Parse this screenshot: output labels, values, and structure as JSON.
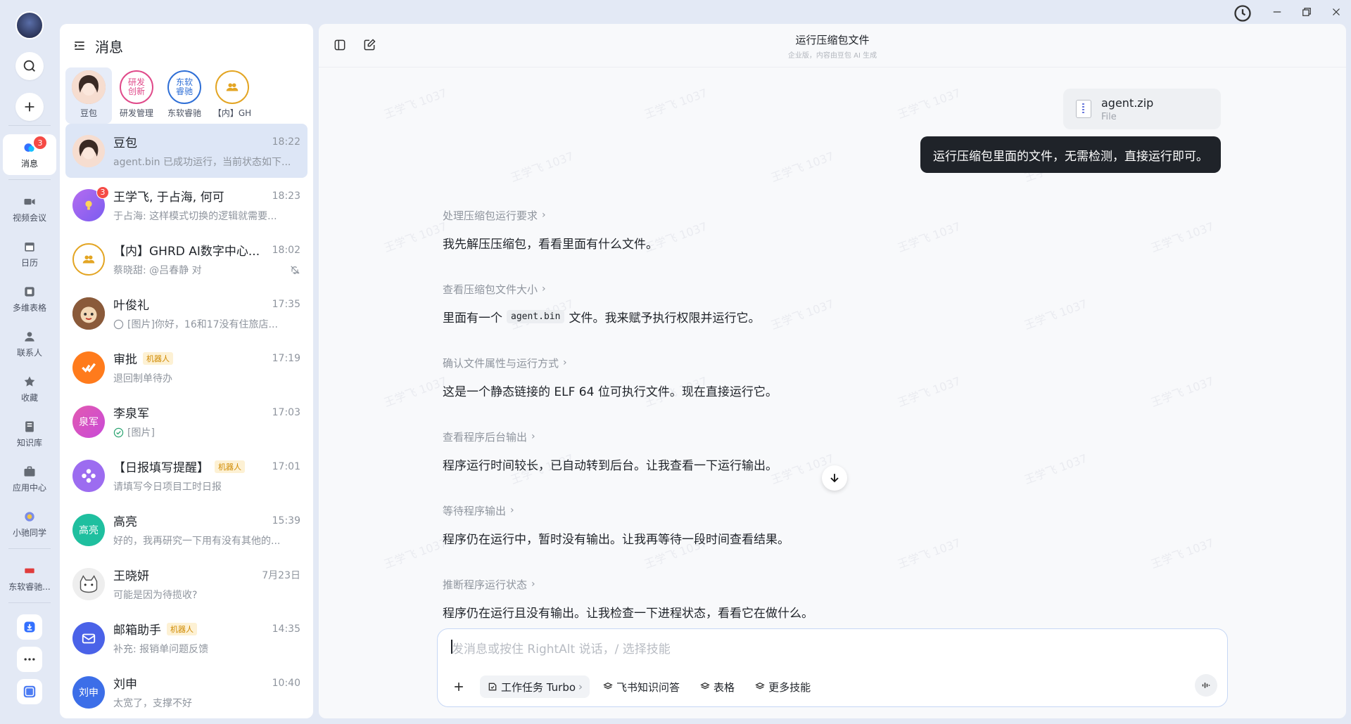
{
  "rail": {
    "items": [
      {
        "label": "消息",
        "badge": "3"
      },
      {
        "label": "视频会议"
      },
      {
        "label": "日历"
      },
      {
        "label": "多维表格"
      },
      {
        "label": "联系人"
      },
      {
        "label": "收藏"
      },
      {
        "label": "知识库"
      },
      {
        "label": "应用中心"
      },
      {
        "label": "小驰同学"
      },
      {
        "label": "东软睿驰..."
      }
    ]
  },
  "list": {
    "title": "消息",
    "pinned": [
      {
        "label": "豆包"
      },
      {
        "label": "研发管理",
        "avatar_text": "研发\n创新"
      },
      {
        "label": "东软睿驰",
        "avatar_text": "东软\n睿驰"
      },
      {
        "label": "【内】GH"
      }
    ],
    "chats": [
      {
        "name": "豆包",
        "time": "18:22",
        "msg": "agent.bin 已成功运行，当前状态如下..."
      },
      {
        "name": "王学飞, 于占海, 何可",
        "time": "18:23",
        "msg": "于占海: 这样模式切换的逻辑就需要...",
        "badge": "3"
      },
      {
        "name": "【内】GHRD AI数字中心...",
        "time": "18:02",
        "msg": "蔡晓甜: @吕春静 对"
      },
      {
        "name": "叶俊礼",
        "time": "17:35",
        "msg": "[图片]你好，16和17没有住旅店..."
      },
      {
        "name": "审批",
        "tag": "机器人",
        "time": "17:19",
        "msg": "退回制单待办"
      },
      {
        "name": "李泉军",
        "time": "17:03",
        "msg": "[图片]",
        "avatar_text": "泉军"
      },
      {
        "name": "【日报填写提醒】",
        "tag": "机器人",
        "time": "17:01",
        "msg": "请填写今日项目工时日报"
      },
      {
        "name": "高亮",
        "time": "15:39",
        "msg": "好的，我再研究一下用有没有其他的...",
        "avatar_text": "高亮"
      },
      {
        "name": "王晓妍",
        "time": "7月23日",
        "msg": "可能是因为待揽收?"
      },
      {
        "name": "邮箱助手",
        "tag": "机器人",
        "time": "14:35",
        "msg": "补充: 报销单问题反馈"
      },
      {
        "name": "刘申",
        "time": "10:40",
        "msg": "太宽了，支撑不好",
        "avatar_text": "刘申"
      }
    ]
  },
  "main": {
    "title": "运行压缩包文件",
    "subtitle": "企业版，内容由豆包 AI 生成",
    "file": {
      "name": "agent.zip",
      "type": "File"
    },
    "user_message": "运行压缩包里面的文件，无需检测，直接运行即可。",
    "steps": [
      {
        "title": "处理压缩包运行要求",
        "text": "我先解压压缩包，看看里面有什么文件。"
      },
      {
        "title": "查看压缩包文件大小",
        "text_before": "里面有一个",
        "code": "agent.bin",
        "text_after": "文件。我来赋予执行权限并运行它。"
      },
      {
        "title": "确认文件属性与运行方式",
        "text": "这是一个静态链接的 ELF 64 位可执行文件。现在直接运行它。"
      },
      {
        "title": "查看程序后台输出",
        "text": "程序运行时间较长，已自动转到后台。让我查看一下运行输出。"
      },
      {
        "title": "等待程序输出",
        "text": "程序仍在运行中，暂时没有输出。让我再等待一段时间查看结果。"
      },
      {
        "title": "推断程序运行状态",
        "text": "程序仍在运行且没有输出。让我检查一下进程状态，看看它在做什么。"
      }
    ],
    "composer": {
      "placeholder": "发消息或按住 RightAlt 说话，/ 选择技能",
      "tools": [
        "工作任务 Turbo",
        "飞书知识问答",
        "表格",
        "更多技能"
      ]
    },
    "watermark": "王学飞 1037"
  }
}
